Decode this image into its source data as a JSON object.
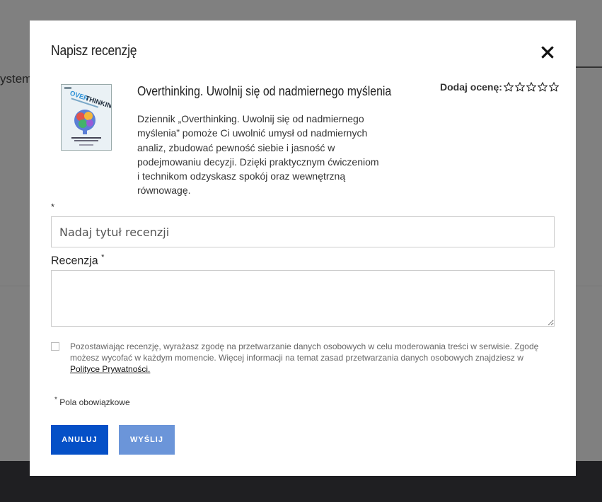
{
  "background": {
    "partial_text": "ystem"
  },
  "modal": {
    "title": "Napisz recenzję",
    "close_icon": "close-icon"
  },
  "product": {
    "cover_text": "OVERTHINKING",
    "title": "Overthinking. Uwolnij się od nadmiernego myślenia",
    "description": "Dziennik „Overthinking. Uwolnij się od nadmiernego myślenia” pomoże Ci uwolnić umysł od nadmiernych analiz, zbudować pewność siebie i jasność w podejmowaniu decyzji. Dzięki praktycznym ćwiczeniom i technikom odzyskasz spokój oraz wewnętrzną równowagę."
  },
  "rating": {
    "label": "Dodaj ocenę:",
    "max_stars": 5,
    "selected": 0
  },
  "form": {
    "required_mark": "*",
    "title_placeholder": "Nadaj tytuł recenzji",
    "title_value": "",
    "review_label": "Recenzja",
    "review_value": "",
    "consent_text": "Pozostawiając recenzję, wyrażasz zgodę na przetwarzanie danych osobowych w celu moderowania treści w serwisie. Zgodę możesz wycofać w każdym momencie. Więcej informacji na temat zasad przetwarzania danych osobowych znajdziesz w",
    "consent_link": "Polityce Prywatności.",
    "consent_checked": false,
    "required_note": "Pola obowiązkowe"
  },
  "buttons": {
    "cancel": "ANULUJ",
    "send": "WYŚLIJ"
  },
  "colors": {
    "primary": "#0550c7",
    "primary_disabled": "#6b95d9",
    "overlay": "#808080",
    "footer": "#1f1f22"
  }
}
